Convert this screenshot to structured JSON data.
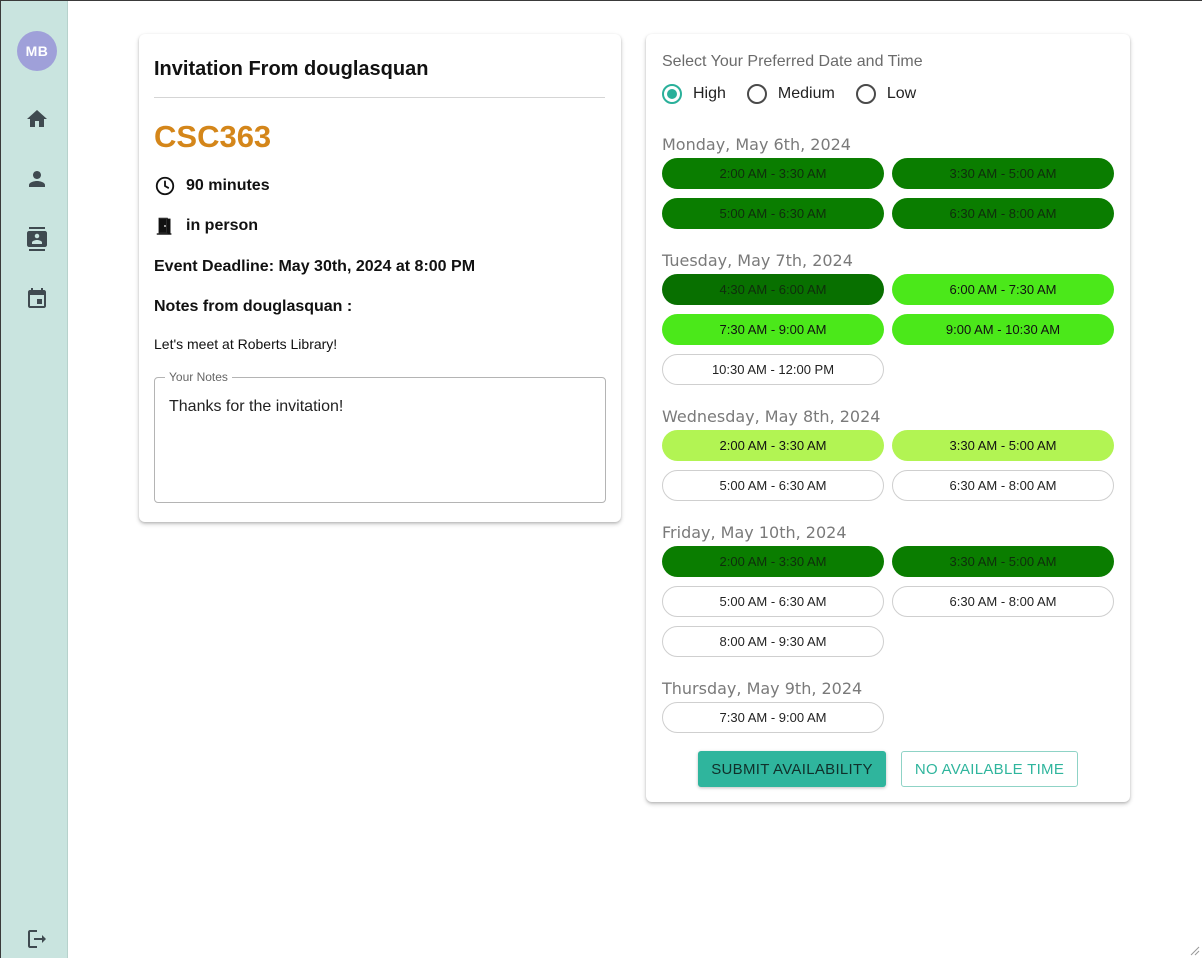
{
  "sidebar": {
    "avatar_initials": "MB",
    "icons": [
      "home-icon",
      "person-icon",
      "contacts-icon",
      "calendar-icon",
      "logout-icon"
    ]
  },
  "invitation": {
    "title": "Invitation From douglasquan",
    "course": "CSC363",
    "course_color": "#d4861a",
    "duration": "90 minutes",
    "location": "in person",
    "deadline": "Event Deadline: May 30th, 2024 at 8:00 PM",
    "notes_heading": "Notes from douglasquan :",
    "notes_text": "Let's meet at Roberts Library!",
    "your_notes_label": "Your Notes",
    "your_notes_value": "Thanks for the invitation!"
  },
  "preferences": {
    "title": "Select Your Preferred Date and Time",
    "options": [
      "High",
      "Medium",
      "Low"
    ],
    "selected": "High",
    "accent": "#2ab09a"
  },
  "legend_colors": {
    "dark": "#0a7d00",
    "bright": "#4be81a",
    "light": "#b2f453",
    "none": "#ffffff"
  },
  "days": [
    {
      "label": "Monday, May 6th, 2024",
      "slots": [
        {
          "time": "2:00 AM - 3:30 AM",
          "level": "dark"
        },
        {
          "time": "3:30 AM - 5:00 AM",
          "level": "dark"
        },
        {
          "time": "5:00 AM - 6:30 AM",
          "level": "dark"
        },
        {
          "time": "6:30 AM - 8:00 AM",
          "level": "dark"
        }
      ]
    },
    {
      "label": "Tuesday, May 7th, 2024",
      "slots": [
        {
          "time": "4:30 AM - 6:00 AM",
          "level": "darker"
        },
        {
          "time": "6:00 AM - 7:30 AM",
          "level": "bright"
        },
        {
          "time": "7:30 AM - 9:00 AM",
          "level": "bright"
        },
        {
          "time": "9:00 AM - 10:30 AM",
          "level": "bright"
        },
        {
          "time": "10:30 AM - 12:00 PM",
          "level": "none"
        }
      ]
    },
    {
      "label": "Wednesday, May 8th, 2024",
      "slots": [
        {
          "time": "2:00 AM - 3:30 AM",
          "level": "light"
        },
        {
          "time": "3:30 AM - 5:00 AM",
          "level": "light"
        },
        {
          "time": "5:00 AM - 6:30 AM",
          "level": "none"
        },
        {
          "time": "6:30 AM - 8:00 AM",
          "level": "none"
        }
      ]
    },
    {
      "label": "Friday, May 10th, 2024",
      "slots": [
        {
          "time": "2:00 AM - 3:30 AM",
          "level": "dark"
        },
        {
          "time": "3:30 AM - 5:00 AM",
          "level": "dark"
        },
        {
          "time": "5:00 AM - 6:30 AM",
          "level": "none"
        },
        {
          "time": "6:30 AM - 8:00 AM",
          "level": "none"
        },
        {
          "time": "8:00 AM - 9:30 AM",
          "level": "none"
        }
      ]
    },
    {
      "label": "Thursday, May 9th, 2024",
      "slots": [
        {
          "time": "7:30 AM - 9:00 AM",
          "level": "none"
        }
      ]
    }
  ],
  "actions": {
    "submit_label": "SUBMIT AVAILABILITY",
    "none_label": "NO AVAILABLE TIME"
  }
}
